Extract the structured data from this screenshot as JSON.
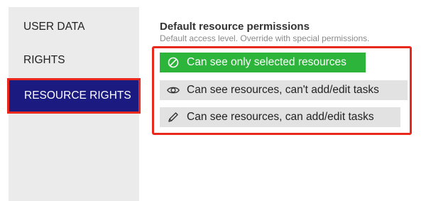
{
  "sidebar": {
    "items": [
      {
        "label": "USER DATA",
        "active": false
      },
      {
        "label": "RIGHTS",
        "active": false
      },
      {
        "label": "RESOURCE RIGHTS",
        "active": true
      }
    ]
  },
  "content": {
    "title": "Default resource permissions",
    "subtitle": "Default access level. Override with special permissions.",
    "options": [
      {
        "label": "Can see only selected resources",
        "icon": "forbidden-circle-icon",
        "selected": true
      },
      {
        "label": "Can see resources, can't add/edit tasks",
        "icon": "eye-icon",
        "selected": false
      },
      {
        "label": "Can see resources, can add/edit tasks",
        "icon": "pencil-icon",
        "selected": false
      }
    ]
  },
  "colors": {
    "active_nav_bg": "#1a1a80",
    "selected_option_bg": "#2cb53a",
    "highlight_border": "#e8281c"
  }
}
